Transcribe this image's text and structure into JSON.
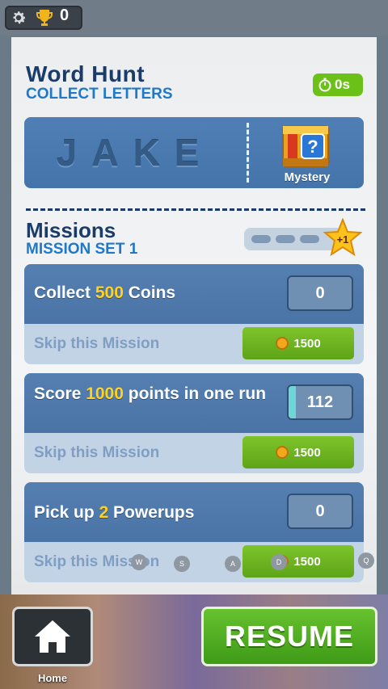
{
  "topbar": {
    "gear_icon": "gear-icon",
    "trophy_icon": "trophy-icon",
    "trophy_count": "0"
  },
  "event": {
    "title": "Word Hunt",
    "subtitle": "COLLECT LETTERS",
    "timer": "0s",
    "word": "JAKE",
    "reward_label": "Mystery"
  },
  "missions": {
    "title": "Missions",
    "subtitle": "MISSION SET 1",
    "progress_badge": "+1",
    "set_progress": {
      "completed": 0,
      "total": 3
    },
    "items": [
      {
        "pre": "Collect ",
        "highlight": "500",
        "post": " Coins",
        "counter": "0",
        "progress_fraction": 0,
        "skip_label": "Skip this Mission",
        "skip_cost": "1500"
      },
      {
        "pre": "Score ",
        "highlight": "1000",
        "post": " points in one run",
        "counter": "112",
        "progress_fraction": 0.112,
        "skip_label": "Skip this Mission",
        "skip_cost": "1500"
      },
      {
        "pre": "Pick up ",
        "highlight": "2",
        "post": " Powerups",
        "counter": "0",
        "progress_fraction": 0,
        "skip_label": "Skip this Mission",
        "skip_cost": "1500"
      }
    ]
  },
  "key_hints": [
    "W",
    "S",
    "A",
    "D",
    "Q"
  ],
  "footer": {
    "home_label": "Home",
    "resume_label": "RESUME"
  },
  "colors": {
    "navy": "#1b3c69",
    "accent_blue": "#1f78c8",
    "green": "#6cc119",
    "highlight_yellow": "#ffd21e"
  }
}
